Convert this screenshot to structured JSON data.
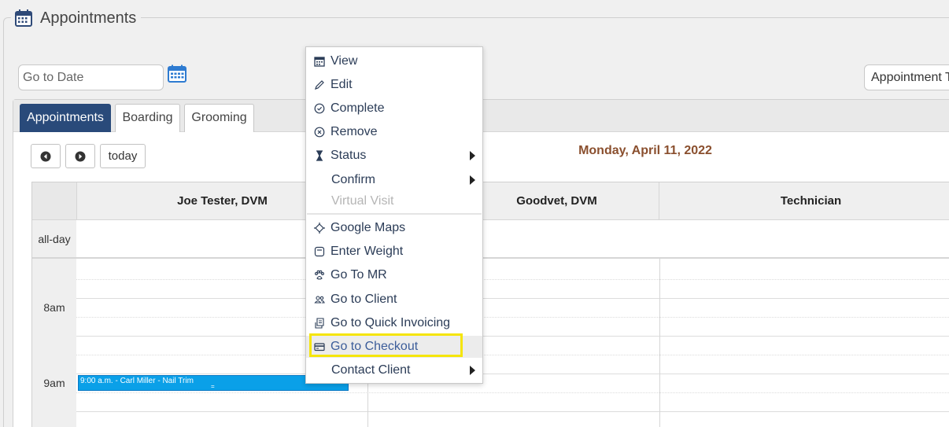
{
  "header": {
    "title": "Appointments",
    "icon": "calendar-icon"
  },
  "toolbar": {
    "go_to_date_placeholder": "Go to Date",
    "calendar_button_icon": "calendar-icon",
    "appointment_type_label": "Appointment T"
  },
  "tabs": [
    {
      "label": "Appointments",
      "active": true
    },
    {
      "label": "Boarding",
      "active": false
    },
    {
      "label": "Grooming",
      "active": false
    }
  ],
  "calendar": {
    "prev_icon": "circle-left-icon",
    "next_icon": "circle-right-icon",
    "today_label": "today",
    "date_heading": "Monday, April 11, 2022",
    "columns": [
      "Joe Tester, DVM",
      "Goodvet, DVM",
      "Technician"
    ],
    "allday_label": "all-day",
    "time_labels": [
      "8am",
      "9am"
    ],
    "event": {
      "text": "9:00 a.m. - Carl Miller - Nail Trim",
      "color": "#0aa0e8"
    }
  },
  "context_menu": {
    "items": [
      {
        "label": "View",
        "icon": "calendar-icon"
      },
      {
        "label": "Edit",
        "icon": "pencil-icon"
      },
      {
        "label": "Complete",
        "icon": "check-circle-icon"
      },
      {
        "label": "Remove",
        "icon": "x-circle-icon"
      },
      {
        "label": "Status",
        "icon": "hourglass-icon",
        "submenu": true
      },
      {
        "label": "Confirm",
        "icon": "",
        "submenu": true
      },
      {
        "label": "Virtual Visit",
        "icon": "",
        "disabled": true
      },
      {
        "label": "Google Maps",
        "icon": "crosshair-icon"
      },
      {
        "label": "Enter Weight",
        "icon": "scale-icon"
      },
      {
        "label": "Go To MR",
        "icon": "paw-icon"
      },
      {
        "label": "Go to Client",
        "icon": "users-icon"
      },
      {
        "label": "Go to Quick Invoicing",
        "icon": "invoice-icon"
      },
      {
        "label": "Go to Checkout",
        "icon": "credit-card-icon",
        "highlighted": true
      },
      {
        "label": "Contact Client",
        "icon": "",
        "submenu": true
      }
    ]
  },
  "colors": {
    "active_tab": "#294a7a",
    "date_heading": "#8a4f2e",
    "highlight_box": "#f5e50a",
    "event": "#0aa0e8"
  }
}
